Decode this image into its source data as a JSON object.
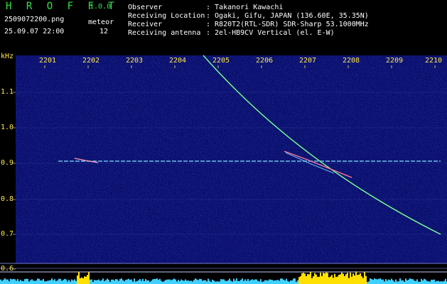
{
  "app": {
    "title": "H R O F F T",
    "version": "1.0.0"
  },
  "file": {
    "name": "2509072200.png",
    "datetime": "25.09.07 22:00"
  },
  "meteor": {
    "label": "meteor",
    "count": "12"
  },
  "info": [
    {
      "label": "Observer",
      "value": ": Takanori Kawachi"
    },
    {
      "label": "Receiving Location",
      "value": ": Ogaki, Gifu, JAPAN (136.60E, 35.35N)"
    },
    {
      "label": "Receiver",
      "value": ": R820T2(RTL-SDR) SDR-Sharp 53.1000MHz"
    },
    {
      "label": "Receiving antenna",
      "value": ": 2el-HB9CV Vertical (el. E-W)"
    }
  ],
  "axis": {
    "unit": "kHz",
    "time_ticks": [
      "2201",
      "2202",
      "2203",
      "2204",
      "2205",
      "2206",
      "2207",
      "2208",
      "2209",
      "2210"
    ],
    "freq_ticks": [
      "1.1",
      "1.0",
      "0.9",
      "0.8",
      "0.7",
      "0.6"
    ]
  },
  "colors": {
    "background": "#000000",
    "spectrogram_base": "#0a0f6e",
    "header_text": "#ffffff",
    "title_green": "#31e04a",
    "tick_text": "#ffe84a",
    "grid": "#9aa0ff",
    "signal_line": "#7fe0ff",
    "sweep_line": "#5cff7a",
    "meteor_trace": "#ff7aa0",
    "level_bar": "#3fd0ff",
    "level_peak": "#ffe000"
  }
}
